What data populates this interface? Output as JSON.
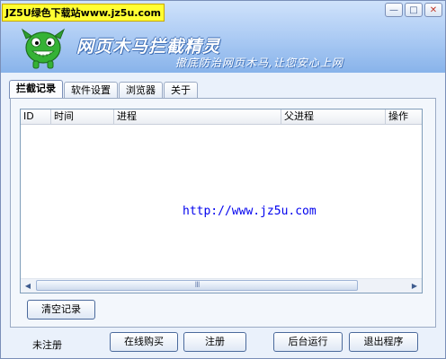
{
  "window": {
    "site_banner": "JZ5U绿色下载站www.jz5u.com",
    "app_title": "网页木马拦截精灵",
    "slogan": "撤底防治网页木马,让您安心上网",
    "minimize_glyph": "—",
    "maximize_glyph": "□",
    "close_glyph": "✕"
  },
  "tabs": [
    {
      "label": "拦截记录",
      "active": true
    },
    {
      "label": "软件设置",
      "active": false
    },
    {
      "label": "浏览器",
      "active": false
    },
    {
      "label": "关于",
      "active": false
    }
  ],
  "table": {
    "columns": [
      "ID",
      "时间",
      "进程",
      "父进程",
      "操作"
    ],
    "rows": [],
    "watermark_url": "http://www.jz5u.com",
    "scroll_left_glyph": "◀",
    "scroll_right_glyph": "▶",
    "scroll_thumb_grip": "III"
  },
  "buttons": {
    "clear_records": "清空记录",
    "buy_online": "在线购买",
    "register": "注册",
    "run_background": "后台运行",
    "exit": "退出程序"
  },
  "status": {
    "registration": "未注册"
  },
  "icons": {
    "mascot": "green-monster-mascot-icon"
  },
  "colors": {
    "header_blue": "#a9c9f3",
    "banner_yellow": "#ffff33",
    "link_blue": "#0000ee"
  }
}
